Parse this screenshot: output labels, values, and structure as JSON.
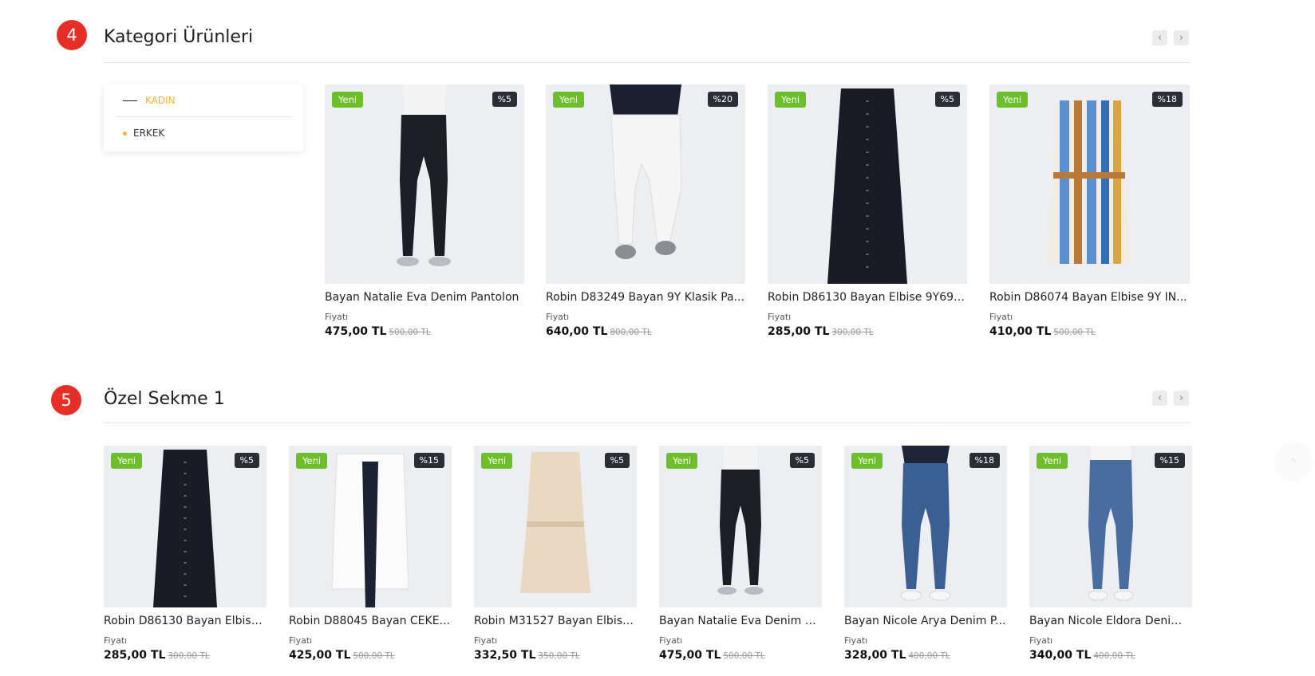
{
  "section1": {
    "number": "4",
    "title": "Kategori Ürünleri",
    "prev_icon": "‹",
    "next_icon": "›",
    "categories": [
      {
        "label": "KADIN",
        "active": true
      },
      {
        "label": "ERKEK",
        "active": false
      }
    ],
    "products": [
      {
        "name": "Bayan Natalie Eva Denim Pantolon",
        "badge_new": "Yeni",
        "discount": "%5",
        "price_label": "Fiyatı",
        "price": "475,00 TL",
        "old_price": "500,00 TL"
      },
      {
        "name": "Robin D83249 Bayan 9Y Klasik Pa...",
        "badge_new": "Yeni",
        "discount": "%20",
        "price_label": "Fiyatı",
        "price": "640,00 TL",
        "old_price": "800,00 TL"
      },
      {
        "name": "Robin D86130 Bayan Elbise 9Y69 ...",
        "badge_new": "Yeni",
        "discount": "%5",
        "price_label": "Fiyatı",
        "price": "285,00 TL",
        "old_price": "300,00 TL"
      },
      {
        "name": "Robin D86074 Bayan Elbise 9Y IN...",
        "badge_new": "Yeni",
        "discount": "%18",
        "price_label": "Fiyatı",
        "price": "410,00 TL",
        "old_price": "500,00 TL"
      }
    ]
  },
  "section2": {
    "number": "5",
    "title": "Özel Sekme 1",
    "prev_icon": "‹",
    "next_icon": "›",
    "products": [
      {
        "name": "Robin D86130 Bayan Elbise ...",
        "badge_new": "Yeni",
        "discount": "%5",
        "price_label": "Fiyatı",
        "price": "285,00 TL",
        "old_price": "300,00 TL"
      },
      {
        "name": "Robin D88045 Bayan CEKE...",
        "badge_new": "Yeni",
        "discount": "%15",
        "price_label": "Fiyatı",
        "price": "425,00 TL",
        "old_price": "500,00 TL"
      },
      {
        "name": "Robin M31527 Bayan Elbise ...",
        "badge_new": "Yeni",
        "discount": "%5",
        "price_label": "Fiyatı",
        "price": "332,50 TL",
        "old_price": "350,00 TL"
      },
      {
        "name": "Bayan Natalie Eva Denim Pa...",
        "badge_new": "Yeni",
        "discount": "%5",
        "price_label": "Fiyatı",
        "price": "475,00 TL",
        "old_price": "500,00 TL"
      },
      {
        "name": "Bayan Nicole Arya Denim P...",
        "badge_new": "Yeni",
        "discount": "%18",
        "price_label": "Fiyatı",
        "price": "328,00 TL",
        "old_price": "400,00 TL"
      },
      {
        "name": "Bayan Nicole Eldora Denim ...",
        "badge_new": "Yeni",
        "discount": "%15",
        "price_label": "Fiyatı",
        "price": "340,00 TL",
        "old_price": "400,00 TL"
      }
    ]
  },
  "scroll_top_icon": "^",
  "colors": {
    "accent": "#f3b52b",
    "badge_new": "#6cbf2a",
    "badge_discount": "#2a2f36",
    "section_number": "#e63027"
  }
}
